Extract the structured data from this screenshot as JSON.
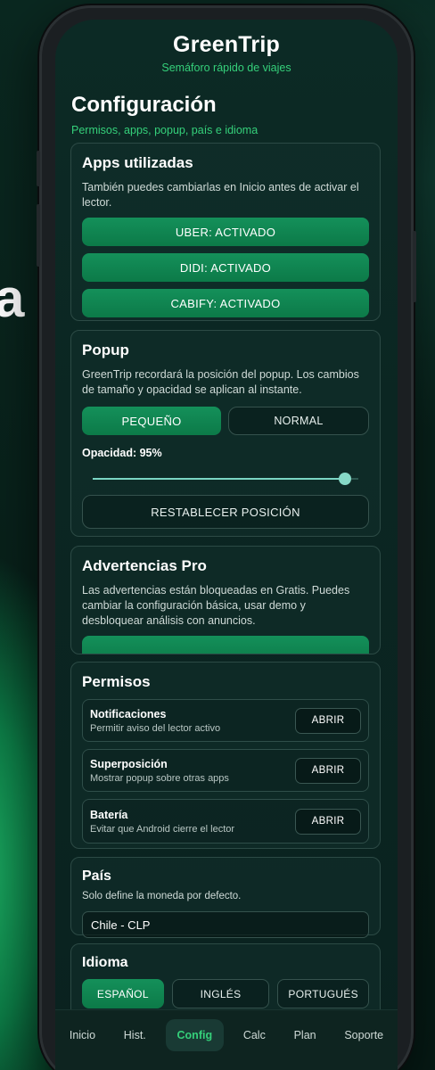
{
  "background_letter": "a",
  "app": {
    "title": "GreenTrip",
    "subtitle": "Semáforo rápido de viajes"
  },
  "page": {
    "title": "Configuración",
    "subtitle": "Permisos, apps, popup, país e idioma"
  },
  "apps_card": {
    "title": "Apps utilizadas",
    "text": "También puedes cambiarlas en Inicio antes de activar el lector.",
    "buttons": [
      "UBER: ACTIVADO",
      "DIDI: ACTIVADO",
      "CABIFY: ACTIVADO"
    ]
  },
  "popup_card": {
    "title": "Popup",
    "text": "GreenTrip recordará la posición del popup. Los cambios de tamaño y opacidad se aplican al instante.",
    "size_small": "PEQUEÑO",
    "size_normal": "NORMAL",
    "selected_size": "PEQUEÑO",
    "opacity_label": "Opacidad: 95%",
    "opacity_value": 0.95,
    "reset_button": "RESTABLECER POSICIÓN"
  },
  "pro_card": {
    "title": "Advertencias Pro",
    "text": "Las advertencias están bloqueadas en Gratis. Puedes cambiar la configuración básica, usar demo y desbloquear análisis con anuncios."
  },
  "permissions_card": {
    "title": "Permisos",
    "items": [
      {
        "title": "Notificaciones",
        "desc": "Permitir aviso del lector activo",
        "button": "ABRIR"
      },
      {
        "title": "Superposición",
        "desc": "Mostrar popup sobre otras apps",
        "button": "ABRIR"
      },
      {
        "title": "Batería",
        "desc": "Evitar que Android cierre el lector",
        "button": "ABRIR"
      }
    ]
  },
  "country_card": {
    "title": "País",
    "text": "Solo define la moneda por defecto.",
    "selected": "Chile - CLP"
  },
  "language_card": {
    "title": "Idioma",
    "options": [
      "ESPAÑOL",
      "INGLÉS",
      "PORTUGUÉS"
    ],
    "selected": "ESPAÑOL"
  },
  "nav": {
    "items": [
      "Inicio",
      "Hist.",
      "Config",
      "Calc",
      "Plan",
      "Soporte"
    ],
    "active": "Config"
  },
  "colors": {
    "accent_green": "#35d07a",
    "button_green": "#0f8551",
    "card_border": "#2c4a45",
    "screen_bg": "#0b2622"
  }
}
